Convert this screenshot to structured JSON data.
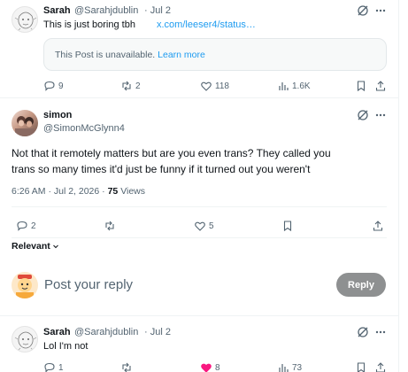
{
  "tweet_top": {
    "author_name": "Sarah",
    "author_handle": "@Sarahjdublin",
    "date": "· Jul 2",
    "text": "This is just boring tbh",
    "link": "x.com/leeser4/status…",
    "quote_unavailable": "This Post is unavailable.",
    "quote_learn_more": "Learn more",
    "replies": "9",
    "reposts": "2",
    "likes": "118",
    "views": "1.6K"
  },
  "main_tweet": {
    "author_name": "simon",
    "author_handle": "@SimonMcGlynn4",
    "text_line1": "Not that it remotely matters but are you even trans? They called you",
    "text_line2": "trans so many times it'd just be funny if it turned out you weren't",
    "timestamp": "6:26 AM · Jul 2, 2026 ·",
    "views_count": "75",
    "views_label": "Views",
    "replies": "2",
    "reposts": "",
    "likes": "5"
  },
  "sort": {
    "label": "Relevant"
  },
  "composer": {
    "placeholder": "Post your reply",
    "reply_button": "Reply"
  },
  "tweet_bottom": {
    "author_name": "Sarah",
    "author_handle": "@Sarahjdublin",
    "date": "· Jul 2",
    "text": "Lol I'm not",
    "replies": "1",
    "likes": "8",
    "views": "73"
  },
  "icons": {
    "grok": "grok-slash-icon",
    "more": "more-dots-icon",
    "reply": "reply-bubble-icon",
    "repost": "repost-arrows-icon",
    "like": "heart-icon",
    "views": "views-bars-icon",
    "bookmark": "bookmark-icon",
    "share": "share-upload-icon"
  },
  "colors": {
    "text": "#0f1419",
    "secondary": "#536471",
    "link": "#1d9bf0",
    "like_active": "#f91880",
    "reply_button": "#8e9091"
  }
}
